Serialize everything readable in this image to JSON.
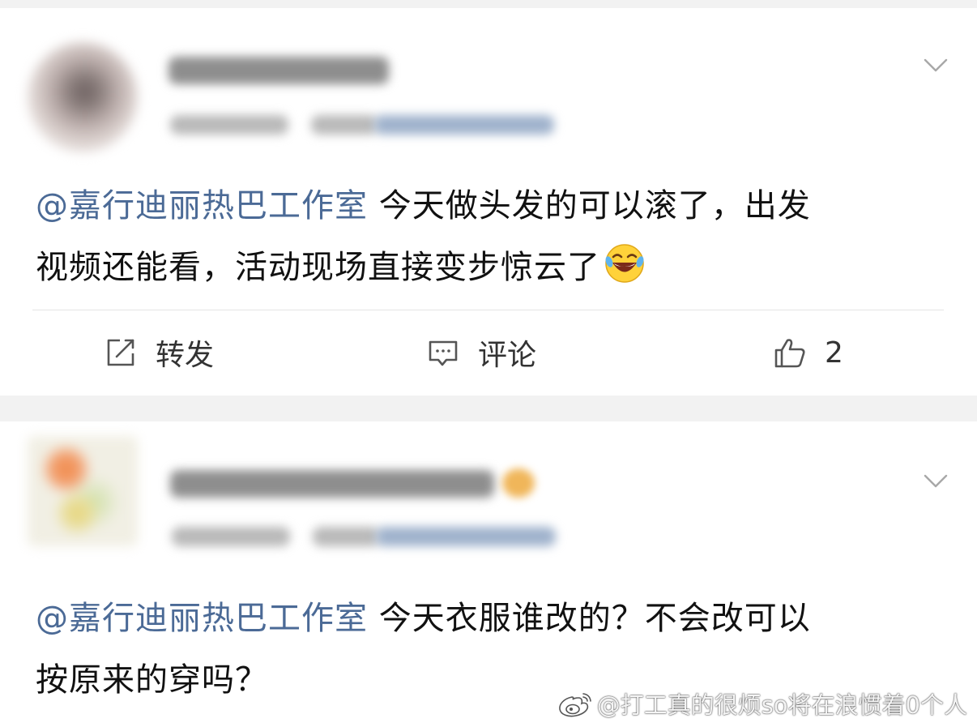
{
  "posts": [
    {
      "mention": "@嘉行迪丽热巴工作室",
      "text_line1": " 今天做头发的可以滚了，出发",
      "text_line2": "视频还能看，活动现场直接变步惊云了",
      "emoji": "laughing-crying-emoji"
    },
    {
      "mention": "@嘉行迪丽热巴工作室",
      "text_line1": " 今天衣服谁改的？不会改可以",
      "text_line2": "按原来的穿吗？"
    }
  ],
  "actions": {
    "repost_label": "转发",
    "comment_label": "评论",
    "like_count": "2"
  },
  "watermark": {
    "text": "@打工真的很烦so将在浪惯着0个人"
  },
  "colors": {
    "mention": "#4b6a96",
    "text": "#111111",
    "divider": "#e4e4e4",
    "background": "#f2f2f2"
  }
}
